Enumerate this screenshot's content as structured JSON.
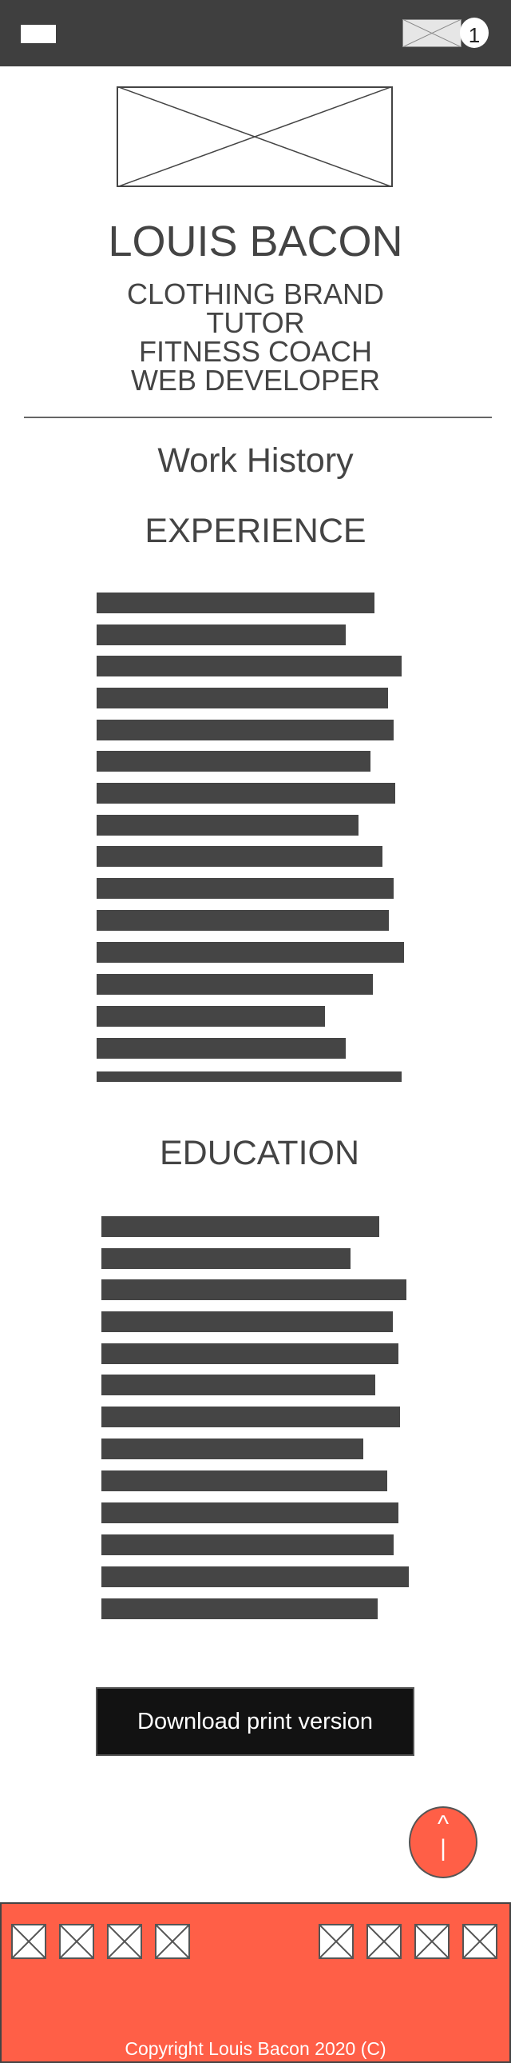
{
  "header": {
    "menu_icon": "menu-icon",
    "mail_icon": "mail-icon",
    "mail_count": "1"
  },
  "profile": {
    "name": "LOUIS BACON",
    "roles": [
      "CLOTHING BRAND",
      "TUTOR",
      "FITNESS COACH",
      "WEB DEVELOPER"
    ]
  },
  "sections": {
    "work_history": "Work History",
    "experience": "EXPERIENCE",
    "education": "EDUCATION"
  },
  "actions": {
    "download_label": "Download print version",
    "back_to_top_caret": "^",
    "back_to_top_stem": "|"
  },
  "footer": {
    "copyright": "Copyright Louis Bacon 2020 (C)"
  },
  "colors": {
    "header_bg": "#3f3f3f",
    "accent": "#ff5f47",
    "text": "#444444",
    "button_bg": "#121212"
  }
}
